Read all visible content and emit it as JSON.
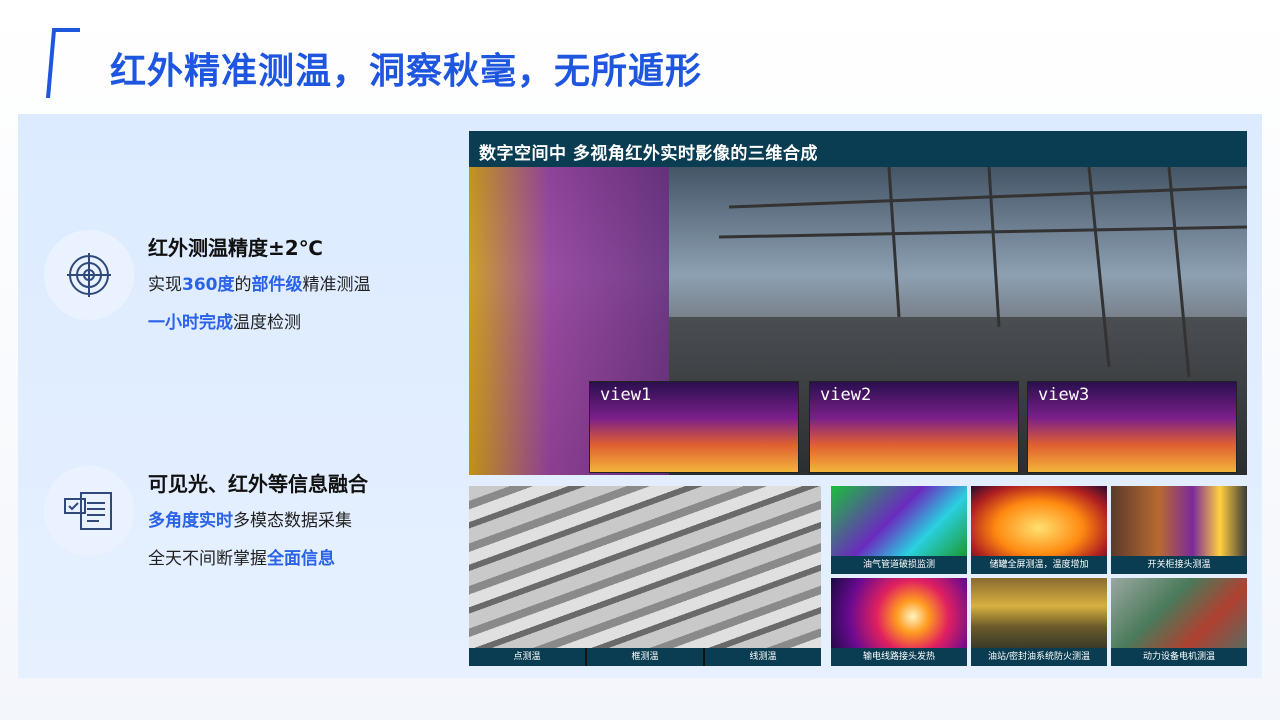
{
  "title": "红外精准测温，洞察秋毫，无所遁形",
  "features": [
    {
      "icon": "target-icon",
      "heading": "红外测温精度±2℃",
      "line1": {
        "t1": "实现",
        "h1": "360度",
        "t2": "的",
        "h2": "部件级",
        "t3": "精准测温"
      },
      "line2": {
        "h1": "一小时完成",
        "t1": "温度检测"
      }
    },
    {
      "icon": "data-document-icon",
      "heading": "可见光、红外等信息融合",
      "line1": {
        "h1": "多角度实时",
        "t1": "多模态数据采集"
      },
      "line2": {
        "t1": "全天不间断掌握",
        "h1": "全面信息"
      }
    }
  ],
  "top_image": {
    "header": "数字空间中 多视角红外实时影像的三维合成",
    "views": [
      "view1",
      "view2",
      "view3"
    ]
  },
  "bottom_left": {
    "captions": [
      "点测温",
      "框测温",
      "线测温"
    ]
  },
  "tiles": [
    {
      "caption": "油气管道破损监测"
    },
    {
      "caption": "储罐全屏测温，温度增加"
    },
    {
      "caption": "开关柜接头测温"
    },
    {
      "caption": "输电线路接头发热"
    },
    {
      "caption": "油站/密封油系统防火测温"
    },
    {
      "caption": "动力设备电机测温"
    }
  ],
  "colors": {
    "accent": "#2a62e8",
    "title": "#1e56e0",
    "caption_bar": "#0b3d52"
  }
}
